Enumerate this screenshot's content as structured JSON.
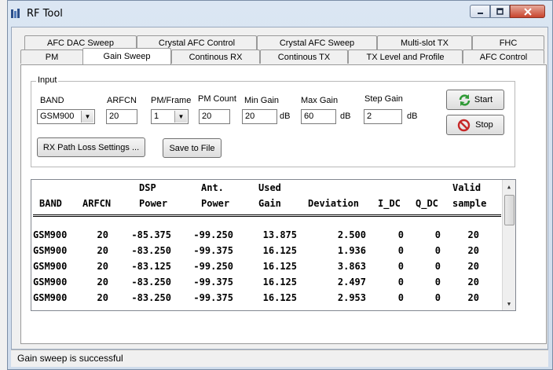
{
  "window": {
    "title": "RF Tool"
  },
  "tabs_row1": [
    "AFC DAC Sweep",
    "Crystal AFC Control",
    "Crystal AFC Sweep",
    "Multi-slot TX",
    "FHC"
  ],
  "tabs_row2": [
    "PM",
    "Gain Sweep",
    "Continous RX",
    "Continous TX",
    "TX Level and Profile",
    "AFC Control"
  ],
  "active_tab": "Gain Sweep",
  "input": {
    "group_label": "Input",
    "band": {
      "label": "BAND",
      "value": "GSM900"
    },
    "arfcn": {
      "label": "ARFCN",
      "value": "20"
    },
    "pm_frame": {
      "label": "PM/Frame",
      "value": "1"
    },
    "pm_count": {
      "label": "PM Count",
      "value": "20"
    },
    "min_gain": {
      "label": "Min Gain",
      "value": "20",
      "unit": "dB"
    },
    "max_gain": {
      "label": "Max Gain",
      "value": "60",
      "unit": "dB"
    },
    "step_gain": {
      "label": "Step Gain",
      "value": "2",
      "unit": "dB"
    },
    "rx_path_button": "RX Path Loss Settings ...",
    "save_button": "Save to File"
  },
  "actions": {
    "start": "Start",
    "stop": "Stop"
  },
  "results": {
    "header_top": [
      "",
      "",
      "DSP",
      "Ant.",
      "Used",
      "",
      "",
      "",
      "Valid"
    ],
    "header_bottom": [
      "BAND",
      "ARFCN",
      "Power",
      "Power",
      "Gain",
      "Deviation",
      "I_DC",
      "Q_DC",
      "sample"
    ],
    "rows": [
      [
        "GSM900",
        "20",
        "-85.375",
        "-99.250",
        "13.875",
        "2.500",
        "0",
        "0",
        "20"
      ],
      [
        "GSM900",
        "20",
        "-83.250",
        "-99.375",
        "16.125",
        "1.936",
        "0",
        "0",
        "20"
      ],
      [
        "GSM900",
        "20",
        "-83.125",
        "-99.250",
        "16.125",
        "3.863",
        "0",
        "0",
        "20"
      ],
      [
        "GSM900",
        "20",
        "-83.250",
        "-99.375",
        "16.125",
        "2.497",
        "0",
        "0",
        "20"
      ],
      [
        "GSM900",
        "20",
        "-83.250",
        "-99.375",
        "16.125",
        "2.953",
        "0",
        "0",
        "20"
      ]
    ]
  },
  "status": {
    "text": "Gain sweep is successful"
  },
  "colors": {
    "start_icon": "#2f9a36",
    "stop_icon": "#c62828"
  }
}
